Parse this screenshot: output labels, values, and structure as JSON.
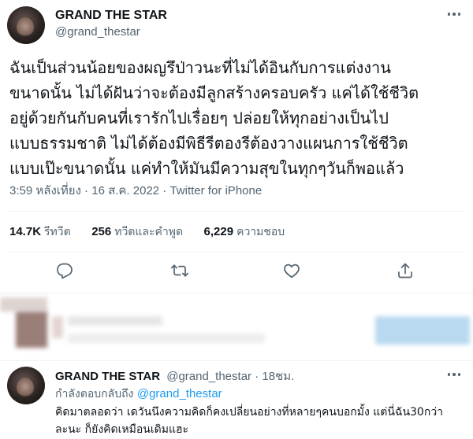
{
  "tweet": {
    "author_name": "GRAND THE STAR",
    "author_handle": "@grand_thestar",
    "text_lines": [
      "ฉันเป็นส่วนน้อยของผญรึป่าวนะที่ไม่ได้อินกับการแต่งงาน",
      "ขนาดนั้น ไม่ได้ฝันว่าจะต้องมีลูกสร้างครอบครัว แค่ได้ใช้ชีวิต",
      "อยู่ด้วยกันกับคนที่เรารักไปเรื่อยๆ ปล่อยให้ทุกอย่างเป็นไป",
      "แบบธรรมชาติ ไม่ได้ต้องมีพิธีรีตองรีต้องวางแผนการใช้ชีวิต",
      "แบบเป๊ะขนาดนั้น แค่ทำให้มันมีความสุขในทุกๆวันก็พอแล้ว"
    ],
    "timestamp": "3:59 หลังเที่ยง · 16 ส.ค. 2022 · Twitter for iPhone",
    "stats": {
      "retweets_count": "14.7K",
      "retweets_label": "รีทวีต",
      "quotes_count": "256",
      "quotes_label": "ทวีตและคำพูด",
      "likes_count": "6,229",
      "likes_label": "ความชอบ"
    },
    "actions": [
      "reply-icon",
      "retweet-icon",
      "like-icon",
      "share-icon"
    ]
  },
  "reply": {
    "author_name": "GRAND THE STAR",
    "author_handle": "@grand_thestar · 18ชม.",
    "replying_prefix": "กำลังตอบกลับถึง",
    "replying_to": "@grand_thestar",
    "text_lines": [
      "คิดมาตลอดว่า เดวันนึงความคิดก็คงเปลี่ยนอย่างที่หลายๆคนบอกมั้ง แต่นี่ฉัน30กว่า",
      "ละนะ ก็ยังคิดเหมือนเดิมแฮะ"
    ]
  },
  "colors": {
    "text_primary": "#0f1419",
    "text_secondary": "#536471",
    "accent": "#1d9bf0",
    "divider": "#eff3f4"
  }
}
